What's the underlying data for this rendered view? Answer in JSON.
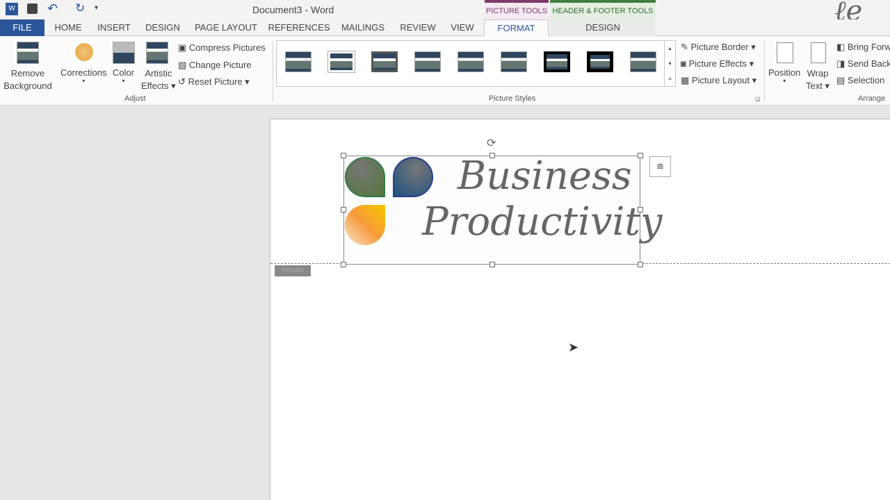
{
  "title": "Document3 - Word",
  "quick_access": {
    "icons": [
      "word-icon",
      "save-icon",
      "undo-icon",
      "redo-icon",
      "customize-icon"
    ]
  },
  "context": {
    "picture_tools": "PICTURE TOOLS",
    "header_footer_tools": "HEADER & FOOTER TOOLS",
    "picture_color": "#7a3a6b",
    "hf_color": "#3f7d3f"
  },
  "tabs": [
    "FILE",
    "HOME",
    "INSERT",
    "DESIGN",
    "PAGE LAYOUT",
    "REFERENCES",
    "MAILINGS",
    "REVIEW",
    "VIEW",
    "FORMAT",
    "DESIGN"
  ],
  "ribbon": {
    "remove_bg": [
      "Remove",
      "Background"
    ],
    "corrections": "Corrections",
    "color": "Color",
    "artistic": [
      "Artistic",
      "Effects"
    ],
    "compress": "Compress Pictures",
    "change": "Change Picture",
    "reset": "Reset Picture",
    "adjust": "Adjust",
    "picture_styles": "Picture Styles",
    "border": "Picture Border",
    "effects": "Picture Effects",
    "layout": "Picture Layout",
    "position": "Position",
    "wrap": [
      "Wrap",
      "Text"
    ],
    "bring": "Bring Forw",
    "send": "Send Back",
    "selection": "Selection",
    "arrange": "Arrange"
  },
  "document": {
    "logo_line1": "Business",
    "logo_line2": "Productivity",
    "header_tag": "Header"
  },
  "accent": "#2b579a"
}
